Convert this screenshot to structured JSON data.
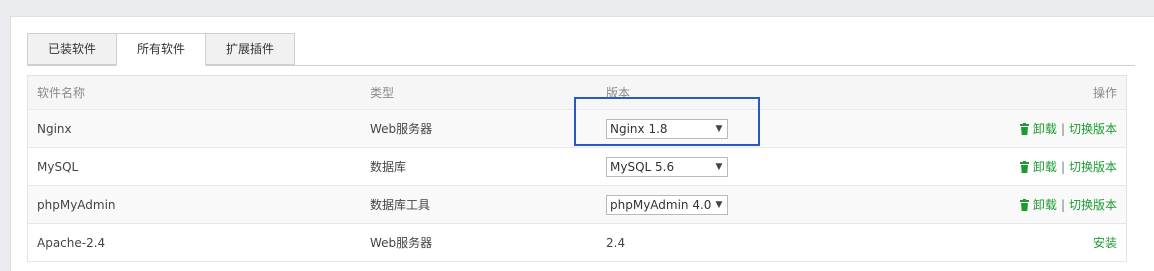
{
  "tabs": [
    {
      "label": "已装软件",
      "active": false
    },
    {
      "label": "所有软件",
      "active": true
    },
    {
      "label": "扩展插件",
      "active": false
    }
  ],
  "table": {
    "headers": {
      "name": "软件名称",
      "type": "类型",
      "version": "版本",
      "ops": "操作"
    },
    "rows": [
      {
        "name": "Nginx",
        "type": "Web服务器",
        "version": "Nginx 1.8",
        "uninstall": "卸载",
        "sep": "|",
        "switch": "切换版本"
      },
      {
        "name": "MySQL",
        "type": "数据库",
        "version": "MySQL 5.6",
        "uninstall": "卸载",
        "sep": "|",
        "switch": "切换版本"
      },
      {
        "name": "phpMyAdmin",
        "type": "数据库工具",
        "version": "phpMyAdmin 4.0",
        "uninstall": "卸载",
        "sep": "|",
        "switch": "切换版本"
      },
      {
        "name": "Apache-2.4",
        "type": "Web服务器",
        "version": "2.4",
        "install": "安装"
      }
    ]
  },
  "colors": {
    "link_green": "#1e9a32",
    "highlight_blue": "#2d57c7"
  },
  "icons": {
    "delete": "trash-icon",
    "dropdown": "chevron-down-icon"
  }
}
